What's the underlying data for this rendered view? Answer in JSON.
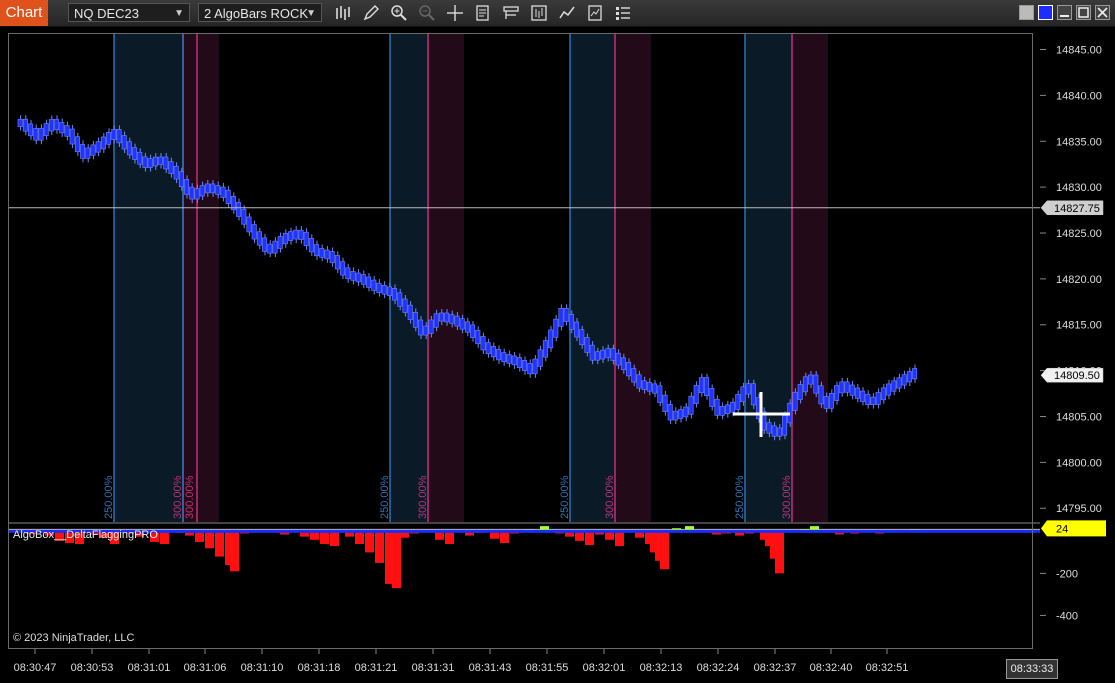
{
  "toolbar": {
    "tab_label": "Chart",
    "instrument": "NQ DEC23",
    "bar_type": "2 AlgoBars ROCK"
  },
  "copyright": "© 2023 NinjaTrader, LLC",
  "indicator_label": "AlgoBox__DeltaFlaggingPRO",
  "current_time": "08:33:33",
  "colors": {
    "accent": "#e0521c",
    "bars": "#2233ff",
    "bars_outline": "#6a88ff",
    "vline_blue": "#2a73b8",
    "vline_pink": "#c0307a",
    "delta_pos": "#aaff33",
    "delta_neg": "#ff1010",
    "zero_line": "#1a2cff",
    "marker_yellow": "#ffff00"
  },
  "icons": [
    "bar-style-icon",
    "drawing-tool-icon",
    "zoom-in-icon",
    "zoom-out-icon",
    "crosshair-icon",
    "data-box-icon",
    "templates-icon",
    "chart-trader-icon",
    "indicators-icon",
    "strategies-icon",
    "properties-icon"
  ],
  "chart_data": [
    {
      "type": "line",
      "name": "price",
      "y_ticks": [
        "14845.00",
        "14840.00",
        "14835.00",
        "14830.00",
        "14825.00",
        "14820.00",
        "14815.00",
        "14810.00",
        "14805.00",
        "14800.00",
        "14795.00"
      ],
      "ylim": [
        14793.5,
        14846.8
      ],
      "crosshair_price": "14827.75",
      "last_price": "14809.50",
      "x_ticks": [
        "08:30:47",
        "08:30:53",
        "08:31:01",
        "08:31:06",
        "08:31:10",
        "08:31:18",
        "08:31:21",
        "08:31:31",
        "08:31:43",
        "08:31:55",
        "08:32:01",
        "08:32:13",
        "08:32:24",
        "08:32:37",
        "08:32:40",
        "08:32:51"
      ],
      "closes": [
        14837,
        14835.5,
        14837,
        14836,
        14833.5,
        14834.5,
        14836,
        14834,
        14832.5,
        14833,
        14831.5,
        14829,
        14830,
        14829.5,
        14827.5,
        14825,
        14823,
        14824.5,
        14825,
        14823,
        14822.5,
        14820.5,
        14820,
        14819,
        14818.5,
        14816.5,
        14814,
        14816,
        14815.5,
        14814.5,
        14812.5,
        14811.5,
        14811,
        14810,
        14813,
        14816.5,
        14814,
        14811.5,
        14812,
        14810.5,
        14808.5,
        14808,
        14805,
        14805.5,
        14809,
        14805.5,
        14806,
        14808.5,
        14804,
        14803,
        14807,
        14809.5,
        14806,
        14808.5,
        14807.5,
        14806.5,
        14808,
        14809,
        14810
      ],
      "zones": [
        {
          "start": 114,
          "end": 183,
          "label_blue": "250.00%",
          "label_pink": "300.00%"
        },
        {
          "start": 390,
          "end": 428,
          "label_blue": "250.00%",
          "label_pink": "300.00%"
        },
        {
          "start": 570,
          "end": 615,
          "label_blue": "250.00%",
          "label_pink": "300.00%"
        },
        {
          "start": 745,
          "end": 792,
          "label_blue": "250.00%",
          "label_pink": "300.00%"
        }
      ],
      "extra_labels": [
        {
          "at": 185,
          "text": "300.00%",
          "color": "pink"
        }
      ]
    },
    {
      "type": "bar",
      "name": "AlgoBox__DeltaFlaggingPRO",
      "y_ticks": [
        "-200",
        "-400"
      ],
      "ylim": [
        -560,
        40
      ],
      "last_value": "24",
      "values": [
        [
          10,
          2
        ],
        [
          15,
          -5
        ],
        [
          20,
          3
        ],
        [
          28,
          -12
        ],
        [
          35,
          4
        ],
        [
          45,
          -20
        ],
        [
          55,
          -45
        ],
        [
          65,
          -55
        ],
        [
          75,
          -60
        ],
        [
          90,
          -15
        ],
        [
          100,
          -30
        ],
        [
          110,
          -60
        ],
        [
          125,
          -10
        ],
        [
          135,
          -25
        ],
        [
          150,
          -50
        ],
        [
          160,
          -60
        ],
        [
          175,
          -8
        ],
        [
          185,
          -20
        ],
        [
          195,
          -50
        ],
        [
          205,
          -80
        ],
        [
          215,
          -120
        ],
        [
          225,
          -160
        ],
        [
          230,
          -190
        ],
        [
          240,
          -10
        ],
        [
          250,
          -5
        ],
        [
          260,
          3
        ],
        [
          280,
          -15
        ],
        [
          290,
          5
        ],
        [
          300,
          -25
        ],
        [
          310,
          -40
        ],
        [
          320,
          -60
        ],
        [
          330,
          -70
        ],
        [
          345,
          -25
        ],
        [
          355,
          -60
        ],
        [
          365,
          -100
        ],
        [
          375,
          -150
        ],
        [
          385,
          -250
        ],
        [
          392,
          -270
        ],
        [
          400,
          -30
        ],
        [
          410,
          -10
        ],
        [
          420,
          3
        ],
        [
          435,
          -40
        ],
        [
          445,
          -60
        ],
        [
          455,
          -5
        ],
        [
          465,
          -20
        ],
        [
          475,
          -8
        ],
        [
          490,
          -35
        ],
        [
          500,
          -55
        ],
        [
          510,
          -10
        ],
        [
          525,
          8
        ],
        [
          540,
          25
        ],
        [
          555,
          -10
        ],
        [
          565,
          -25
        ],
        [
          575,
          -45
        ],
        [
          585,
          -65
        ],
        [
          595,
          -15
        ],
        [
          605,
          -40
        ],
        [
          615,
          -70
        ],
        [
          625,
          -5
        ],
        [
          635,
          -30
        ],
        [
          645,
          -60
        ],
        [
          650,
          -100
        ],
        [
          655,
          -140
        ],
        [
          660,
          -180
        ],
        [
          672,
          15
        ],
        [
          685,
          25
        ],
        [
          700,
          -5
        ],
        [
          712,
          -15
        ],
        [
          722,
          -10
        ],
        [
          735,
          -20
        ],
        [
          745,
          -10
        ],
        [
          760,
          -40
        ],
        [
          765,
          -70
        ],
        [
          770,
          -130
        ],
        [
          775,
          -200
        ],
        [
          790,
          -5
        ],
        [
          800,
          10
        ],
        [
          810,
          25
        ],
        [
          825,
          -5
        ],
        [
          835,
          -15
        ],
        [
          850,
          -10
        ],
        [
          860,
          -5
        ],
        [
          875,
          -10
        ],
        [
          890,
          -5
        ],
        [
          900,
          5
        ],
        [
          910,
          8
        ],
        [
          918,
          5
        ]
      ]
    }
  ]
}
